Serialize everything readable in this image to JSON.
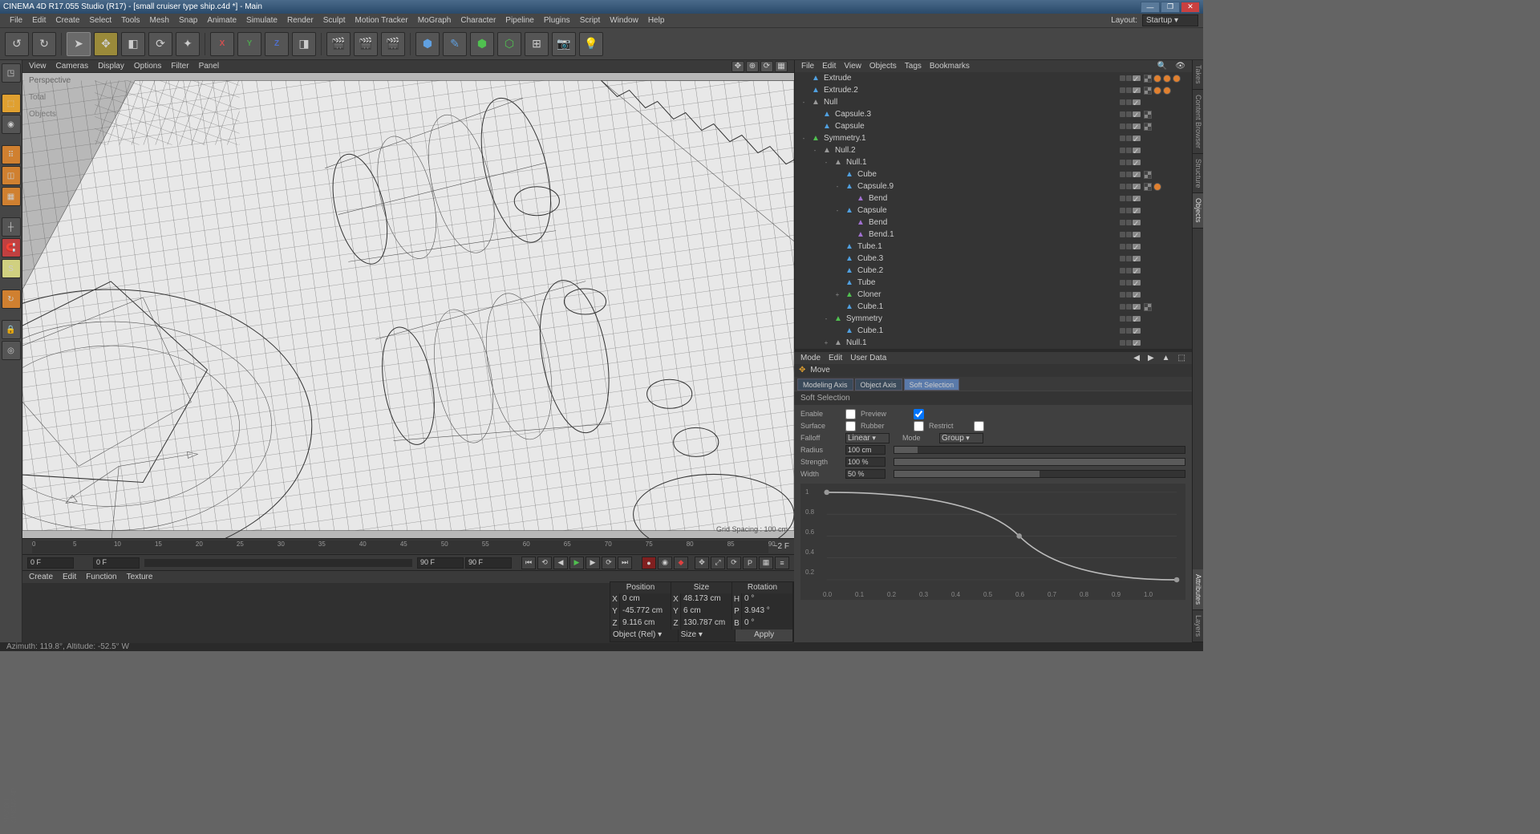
{
  "app": {
    "title": "CINEMA 4D R17.055 Studio (R17) - [small cruiser type ship.c4d *] - Main",
    "layout_label": "Layout:",
    "layout_value": "Startup"
  },
  "menubar": [
    "File",
    "Edit",
    "Create",
    "Select",
    "Tools",
    "Mesh",
    "Snap",
    "Animate",
    "Simulate",
    "Render",
    "Sculpt",
    "Motion Tracker",
    "MoGraph",
    "Character",
    "Pipeline",
    "Plugins",
    "Script",
    "Window",
    "Help"
  ],
  "viewport_menu": [
    "View",
    "Cameras",
    "Display",
    "Options",
    "Filter",
    "Panel"
  ],
  "viewport": {
    "mode": "Perspective",
    "total": "Total",
    "objects": "Objects",
    "grid": "Grid Spacing : 100 cm"
  },
  "timeline": {
    "start": "0 F",
    "end": "90 F",
    "current": "0 F",
    "ticks": [
      "0",
      "5",
      "10",
      "15",
      "20",
      "25",
      "30",
      "35",
      "40",
      "45",
      "50",
      "55",
      "60",
      "65",
      "70",
      "75",
      "80",
      "85",
      "90"
    ],
    "tail": "~2 F"
  },
  "material_menu": [
    "Create",
    "Edit",
    "Function",
    "Texture"
  ],
  "objects": {
    "menu": [
      "File",
      "Edit",
      "View",
      "Objects",
      "Tags",
      "Bookmarks"
    ],
    "tree": [
      {
        "d": 0,
        "exp": "",
        "ico": "ext",
        "name": "Extrude",
        "tags": [
          "c",
          "o",
          "o",
          "o"
        ]
      },
      {
        "d": 0,
        "exp": "",
        "ico": "ext",
        "name": "Extrude.2",
        "tags": [
          "c",
          "o",
          "o"
        ]
      },
      {
        "d": 0,
        "exp": "-",
        "ico": "null",
        "name": "Null",
        "tags": []
      },
      {
        "d": 1,
        "exp": "",
        "ico": "cap",
        "name": "Capsule.3",
        "tags": [
          "c"
        ]
      },
      {
        "d": 1,
        "exp": "",
        "ico": "cap",
        "name": "Capsule",
        "tags": [
          "c"
        ]
      },
      {
        "d": 0,
        "exp": "-",
        "ico": "sym",
        "name": "Symmetry.1",
        "tags": []
      },
      {
        "d": 1,
        "exp": "-",
        "ico": "null",
        "name": "Null.2",
        "tags": []
      },
      {
        "d": 2,
        "exp": "-",
        "ico": "null",
        "name": "Null.1",
        "tags": []
      },
      {
        "d": 3,
        "exp": "",
        "ico": "cube",
        "name": "Cube",
        "tags": [
          "c"
        ]
      },
      {
        "d": 3,
        "exp": "-",
        "ico": "cap",
        "name": "Capsule.9",
        "tags": [
          "c",
          "o"
        ]
      },
      {
        "d": 4,
        "exp": "",
        "ico": "bend",
        "name": "Bend",
        "tags": []
      },
      {
        "d": 3,
        "exp": "-",
        "ico": "cap",
        "name": "Capsule",
        "tags": []
      },
      {
        "d": 4,
        "exp": "",
        "ico": "bend",
        "name": "Bend",
        "tags": []
      },
      {
        "d": 4,
        "exp": "",
        "ico": "bend",
        "name": "Bend.1",
        "tags": []
      },
      {
        "d": 3,
        "exp": "",
        "ico": "tube",
        "name": "Tube.1",
        "tags": []
      },
      {
        "d": 3,
        "exp": "",
        "ico": "cube",
        "name": "Cube.3",
        "tags": []
      },
      {
        "d": 3,
        "exp": "",
        "ico": "cube",
        "name": "Cube.2",
        "tags": []
      },
      {
        "d": 3,
        "exp": "",
        "ico": "tube",
        "name": "Tube",
        "tags": []
      },
      {
        "d": 3,
        "exp": "+",
        "ico": "clon",
        "name": "Cloner",
        "tags": []
      },
      {
        "d": 3,
        "exp": "",
        "ico": "cube",
        "name": "Cube.1",
        "tags": [
          "c"
        ]
      },
      {
        "d": 2,
        "exp": "-",
        "ico": "sym",
        "name": "Symmetry",
        "tags": []
      },
      {
        "d": 3,
        "exp": "",
        "ico": "cube",
        "name": "Cube.1",
        "tags": []
      },
      {
        "d": 2,
        "exp": "+",
        "ico": "null",
        "name": "Null.1",
        "tags": []
      }
    ]
  },
  "attributes": {
    "menu": [
      "Mode",
      "Edit",
      "User Data"
    ],
    "tool": "Move",
    "tabs": [
      "Modeling Axis",
      "Object Axis",
      "Soft Selection"
    ],
    "active_tab": 2,
    "section": "Soft Selection",
    "rows": {
      "enable": "Enable",
      "preview": "Preview",
      "surface": "Surface",
      "rubber": "Rubber",
      "restrict": "Restrict",
      "falloff": "Falloff",
      "falloff_v": "Linear",
      "mode": "Mode",
      "mode_v": "Group",
      "radius": "Radius",
      "radius_v": "100 cm",
      "strength": "Strength",
      "strength_v": "100 %",
      "width": "Width",
      "width_v": "50 %"
    },
    "graph_y": [
      "1",
      "0.8",
      "0.6",
      "0.4",
      "0.2"
    ],
    "graph_x": [
      "0.0",
      "0.1",
      "0.2",
      "0.3",
      "0.4",
      "0.5",
      "0.6",
      "0.7",
      "0.8",
      "0.9",
      "1.0"
    ]
  },
  "coords": {
    "headers": [
      "Position",
      "Size",
      "Rotation"
    ],
    "rows": [
      {
        "axis": "X",
        "p": "0 cm",
        "s": "48.173 cm",
        "rl": "H",
        "r": "0 °"
      },
      {
        "axis": "Y",
        "p": "-45.772 cm",
        "s": "6 cm",
        "rl": "P",
        "r": "3.943 °"
      },
      {
        "axis": "Z",
        "p": "9.116 cm",
        "s": "130.787 cm",
        "rl": "B",
        "r": "0 °"
      }
    ],
    "mode1": "Object (Rel)",
    "mode2": "Size",
    "apply": "Apply"
  },
  "status": "Azimuth: 119.8°, Altitude: -52.5°  W",
  "right_tabs": [
    "Takes",
    "Content Browser",
    "Structure",
    "Objects",
    "Attributes",
    "Layers"
  ]
}
